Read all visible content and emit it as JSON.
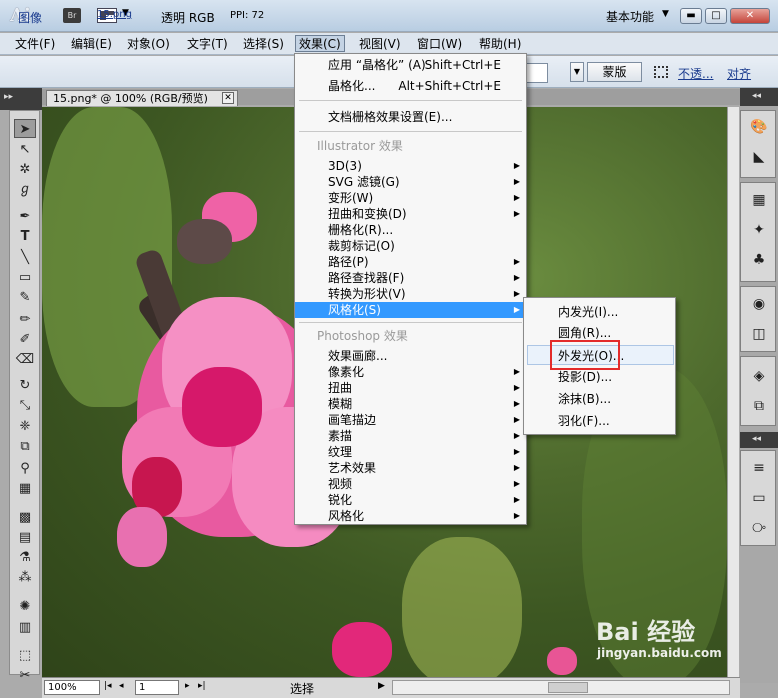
{
  "app": {
    "logo": "Ai",
    "bridge": "Br",
    "workspace": "基本功能"
  },
  "window_buttons": {
    "minimize": "▬",
    "maximize": "□",
    "close": "✕"
  },
  "menubar": [
    "文件(F)",
    "编辑(E)",
    "对象(O)",
    "文字(T)",
    "选择(S)",
    "效果(C)",
    "视图(V)",
    "窗口(W)",
    "帮助(H)"
  ],
  "controlbar": {
    "image_label": "图像",
    "file_link": "15.png",
    "transparency": "透明 RGB",
    "ppi": "PPI: 72",
    "mask_button": "蒙版",
    "opacity_link": "不透...",
    "align_link": "对齐"
  },
  "document": {
    "tab_title": "15.png* @ 100% (RGB/预览)",
    "tab_close": "✕"
  },
  "effect_menu": {
    "items": [
      {
        "label": "应用 “晶格化” (A)",
        "shortcut": "Shift+Ctrl+E"
      },
      {
        "label": "晶格化...",
        "shortcut": "Alt+Shift+Ctrl+E"
      },
      {
        "label": "文档栅格效果设置(E)..."
      },
      {
        "label": "Illustrator 效果",
        "header": true
      },
      {
        "label": "3D(3)",
        "submenu": true
      },
      {
        "label": "SVG 滤镜(G)",
        "submenu": true
      },
      {
        "label": "变形(W)",
        "submenu": true
      },
      {
        "label": "扭曲和变换(D)",
        "submenu": true
      },
      {
        "label": "栅格化(R)..."
      },
      {
        "label": "裁剪标记(O)"
      },
      {
        "label": "路径(P)",
        "submenu": true
      },
      {
        "label": "路径查找器(F)",
        "submenu": true
      },
      {
        "label": "转换为形状(V)",
        "submenu": true
      },
      {
        "label": "风格化(S)",
        "submenu": true,
        "highlighted": true
      },
      {
        "label": "Photoshop 效果",
        "header": true
      },
      {
        "label": "效果画廊..."
      },
      {
        "label": "像素化",
        "submenu": true
      },
      {
        "label": "扭曲",
        "submenu": true
      },
      {
        "label": "模糊",
        "submenu": true
      },
      {
        "label": "画笔描边",
        "submenu": true
      },
      {
        "label": "素描",
        "submenu": true
      },
      {
        "label": "纹理",
        "submenu": true
      },
      {
        "label": "艺术效果",
        "submenu": true
      },
      {
        "label": "视频",
        "submenu": true
      },
      {
        "label": "锐化",
        "submenu": true
      },
      {
        "label": "风格化",
        "submenu": true
      }
    ]
  },
  "stylize_submenu": [
    {
      "label": "内发光(I)..."
    },
    {
      "label": "圆角(R)..."
    },
    {
      "label": "外发光(O)...",
      "hovered": true
    },
    {
      "label": "投影(D)..."
    },
    {
      "label": "涂抹(B)..."
    },
    {
      "label": "羽化(F)..."
    }
  ],
  "statusbar": {
    "zoom": "100%",
    "page": "1",
    "status": "选择"
  },
  "watermark": {
    "brand": "Bai 经验",
    "url": "jingyan.baidu.com"
  },
  "colors": {
    "menu_highlight": "#3399ff",
    "annotation_box": "#e32b2b"
  }
}
